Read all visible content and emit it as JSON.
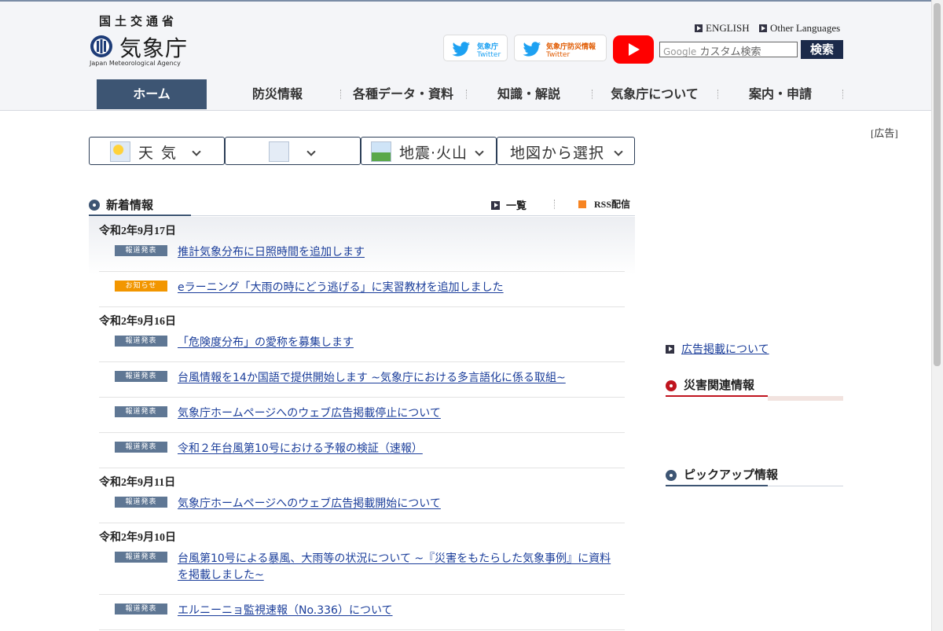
{
  "header": {
    "ministry": "国土交通省",
    "agency_jp": "気象庁",
    "agency_en": "Japan Meteorological Agency",
    "english_link": "ENGLISH",
    "other_languages_link": "Other Languages",
    "twitter1": {
      "line1": "気象庁",
      "line2": "Twitter"
    },
    "twitter2": {
      "line1": "気象庁防災情報",
      "line2": "Twitter"
    },
    "search_placeholder": "カスタム検索",
    "search_brand": "Google",
    "search_button": "検索",
    "colors": {
      "nav_active": "#3d5573",
      "search_button": "#1b2a4a",
      "youtube": "#ff0000",
      "twitter": "#1da1f2"
    }
  },
  "nav": {
    "items": [
      {
        "label": "ホーム",
        "active": true
      },
      {
        "label": "防災情報"
      },
      {
        "label": "各種データ・資料"
      },
      {
        "label": "知識・解説"
      },
      {
        "label": "気象庁について"
      },
      {
        "label": "案内・申請"
      }
    ]
  },
  "dropdowns": [
    {
      "label": "天 気",
      "icon": "sun-cloud-icon"
    },
    {
      "label": "",
      "icon": "snow-rain-icon"
    },
    {
      "label": "地震·火山",
      "icon": "volcano-icon"
    },
    {
      "label": "地図から選択",
      "icon": ""
    }
  ],
  "news": {
    "title": "新着情報",
    "list_link": "一覧",
    "rss_link": "RSS配信",
    "groups": [
      {
        "date": "令和2年9月17日",
        "items": [
          {
            "badge": "報道発表",
            "type": "press",
            "text": "推計気象分布に日照時間を追加します"
          },
          {
            "badge": "お知らせ",
            "type": "notice",
            "text": "eラーニング「大雨の時にどう逃げる」に実習教材を追加しました"
          }
        ]
      },
      {
        "date": "令和2年9月16日",
        "items": [
          {
            "badge": "報道発表",
            "type": "press",
            "text": "「危険度分布」の愛称を募集します"
          },
          {
            "badge": "報道発表",
            "type": "press",
            "text": "台風情報を14か国語で提供開始します ~気象庁における多言語化に係る取組~"
          },
          {
            "badge": "報道発表",
            "type": "press",
            "text": "気象庁ホームページへのウェブ広告掲載停止について"
          },
          {
            "badge": "報道発表",
            "type": "press",
            "text": "令和２年台風第10号における予報の検証（速報）"
          }
        ]
      },
      {
        "date": "令和2年9月11日",
        "items": [
          {
            "badge": "報道発表",
            "type": "press",
            "text": "気象庁ホームページへのウェブ広告掲載開始について"
          }
        ]
      },
      {
        "date": "令和2年9月10日",
        "items": [
          {
            "badge": "報道発表",
            "type": "press",
            "text": "台風第10号による暴風、大雨等の状況について ~『災害をもたらした気象事例』に資料",
            "text2": "を掲載しました~"
          },
          {
            "badge": "報道発表",
            "type": "press",
            "text": "エルニーニョ監視速報（No.336）について"
          }
        ]
      }
    ]
  },
  "sidebar": {
    "ad_label": "[広告]",
    "ad_link": "広告掲載について",
    "disaster_title": "災害関連情報",
    "pickup_title": "ピックアップ情報",
    "colors": {
      "disaster": "#c0141e",
      "pickup": "#3d5573"
    }
  }
}
